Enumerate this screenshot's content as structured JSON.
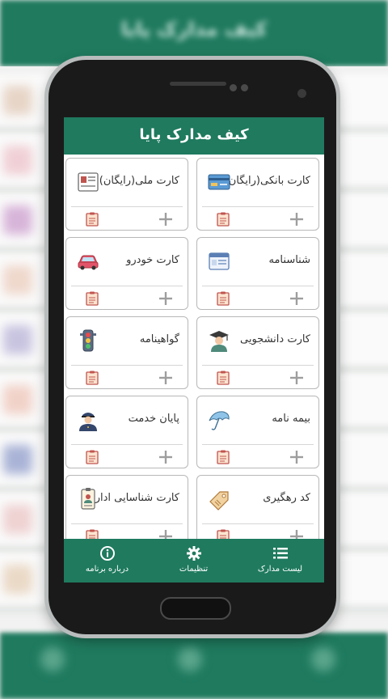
{
  "app": {
    "title": "کیف مدارک پایا",
    "bg_title": "کیف مدارک پایا"
  },
  "cards": [
    {
      "title": "کارت بانکی(رایگان)",
      "icon": "bank-card-icon"
    },
    {
      "title": "کارت ملی(رایگان)",
      "icon": "id-card-icon"
    },
    {
      "title": "شناسنامه",
      "icon": "birth-certificate-icon"
    },
    {
      "title": "کارت خودرو",
      "icon": "car-icon"
    },
    {
      "title": "کارت دانشجویی",
      "icon": "graduate-icon"
    },
    {
      "title": "گواهینامه",
      "icon": "traffic-light-icon"
    },
    {
      "title": "بیمه نامه",
      "icon": "umbrella-icon"
    },
    {
      "title": "پایان خدمت",
      "icon": "soldier-icon"
    },
    {
      "title": "کد رهگیری",
      "icon": "tag-icon"
    },
    {
      "title": "کارت شناسایی اداری",
      "icon": "badge-icon"
    }
  ],
  "nav": {
    "list": "لیست مدارک",
    "settings": "تنظیمات",
    "about": "درباره برنامه"
  },
  "colors": {
    "primary": "#1f7a5e",
    "plus": "#9e9e9e",
    "clipboard": "#c0554f"
  }
}
